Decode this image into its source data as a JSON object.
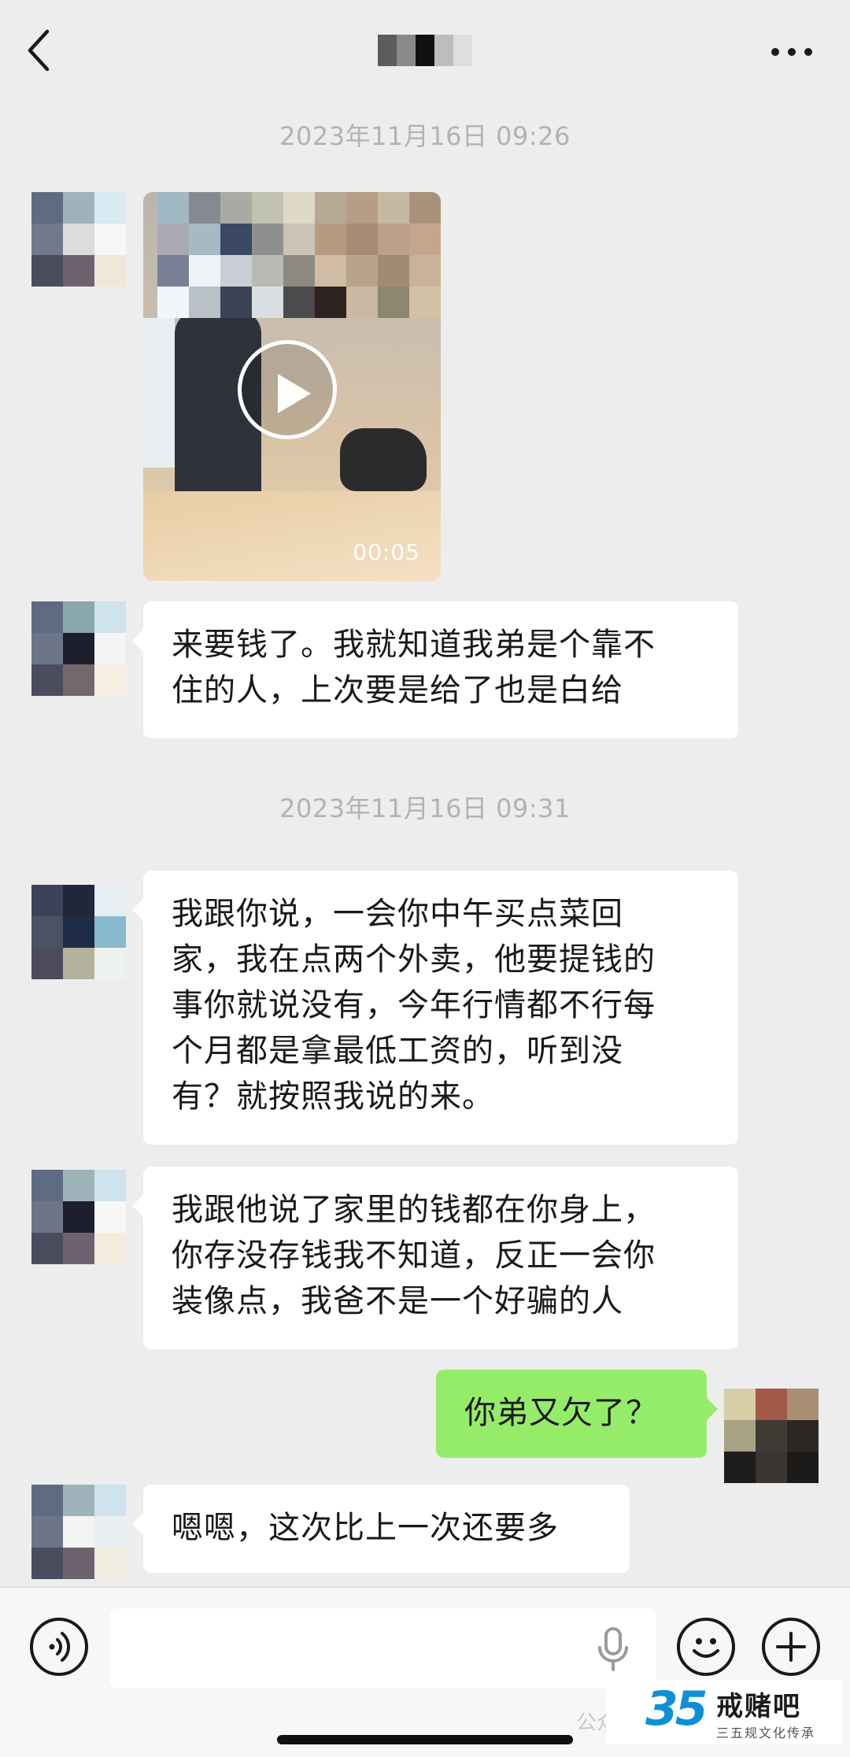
{
  "header": {
    "back_icon": "chevron-left-icon",
    "more_icon": "more-dots-icon",
    "title_obscured": true
  },
  "messages": [
    {
      "type": "timestamp",
      "text": "2023年11月16日 09:26"
    },
    {
      "type": "video",
      "side": "left",
      "duration": "00:05"
    },
    {
      "type": "text",
      "side": "left",
      "lines": [
        "来要钱了。我就知道我弟是个靠不",
        "住的人，上次要是给了也是白给"
      ]
    },
    {
      "type": "timestamp",
      "text": "2023年11月16日 09:31"
    },
    {
      "type": "text",
      "side": "left",
      "lines": [
        "我跟你说，一会你中午买点菜回",
        "家，我在点两个外卖，他要提钱的",
        "事你就说没有，今年行情都不行每",
        "个月都是拿最低工资的，听到没",
        "有？就按照我说的来。"
      ]
    },
    {
      "type": "text",
      "side": "left",
      "lines": [
        "我跟他说了家里的钱都在你身上，",
        "你存没存钱我不知道，反正一会你",
        "装像点，我爸不是一个好骗的人"
      ]
    },
    {
      "type": "text",
      "side": "right",
      "lines": [
        "你弟又欠了？"
      ]
    },
    {
      "type": "text",
      "side": "left",
      "lines": [
        "嗯嗯，这次比上一次还要多"
      ]
    }
  ],
  "input_bar": {
    "voice_icon": "voice-icon",
    "mic_icon": "microphone-icon",
    "emoji_icon": "emoji-icon",
    "plus_icon": "plus-icon"
  },
  "watermark": {
    "number": "35",
    "name": "戒赌吧",
    "subtitle": "三五规文化传承",
    "account_prefix": "公众号"
  },
  "colors": {
    "background": "#ededed",
    "bubble_left": "#ffffff",
    "bubble_right": "#95ec69",
    "timestamp": "#b2b2b2"
  }
}
